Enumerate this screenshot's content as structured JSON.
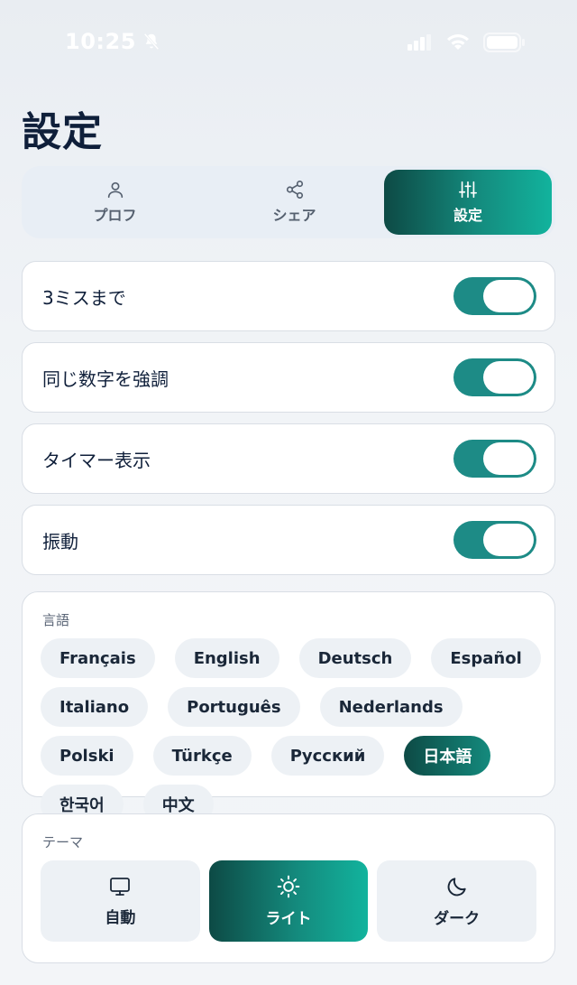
{
  "status": {
    "time": "10:25",
    "icons": [
      "bell-slash-icon",
      "signal-icon",
      "wifi-icon",
      "battery-icon"
    ]
  },
  "title": "設定",
  "tabs": [
    {
      "label": "プロフ",
      "icon": "person-icon",
      "active": false
    },
    {
      "label": "シェア",
      "icon": "share-icon",
      "active": false
    },
    {
      "label": "設定",
      "icon": "sliders-icon",
      "active": true
    }
  ],
  "toggles": [
    {
      "label": "3ミスまで",
      "on": true
    },
    {
      "label": "同じ数字を強調",
      "on": true
    },
    {
      "label": "タイマー表示",
      "on": true
    },
    {
      "label": "振動",
      "on": true
    }
  ],
  "language": {
    "label": "言語",
    "options": [
      "Français",
      "English",
      "Deutsch",
      "Español",
      "Italiano",
      "Português",
      "Nederlands",
      "Polski",
      "Türkçe",
      "Русский",
      "日本語",
      "한국어",
      "中文"
    ],
    "selected": "日本語"
  },
  "theme": {
    "label": "テーマ",
    "options": [
      {
        "label": "自動",
        "icon": "monitor-icon"
      },
      {
        "label": "ライト",
        "icon": "sun-icon"
      },
      {
        "label": "ダーク",
        "icon": "moon-icon"
      }
    ],
    "selected": "ライト"
  },
  "colors": {
    "accent": "#148a7d",
    "accent_dark": "#0d4a45",
    "toggle_on": "#1d8b86",
    "text": "#0f1f3a"
  }
}
